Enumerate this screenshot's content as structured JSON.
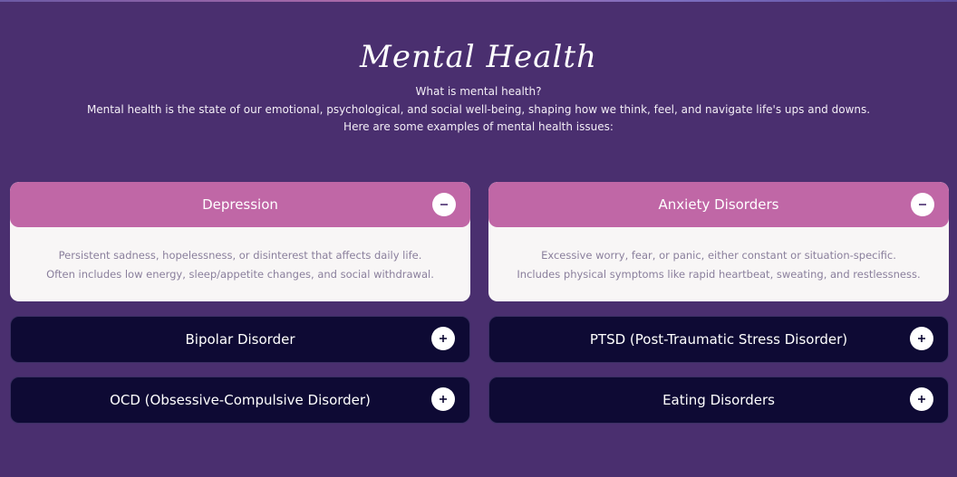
{
  "header": {
    "title": "Mental Health",
    "question": "What is mental health?",
    "definition": "Mental health is the state of our emotional, psychological, and social well-being, shaping how we think, feel, and navigate life's ups and downs.",
    "examples_intro": "Here are some examples of mental health issues:"
  },
  "cards": [
    {
      "title": "Depression",
      "state": "expanded",
      "toggle_icon": "minus-icon",
      "lines": [
        "Persistent sadness, hopelessness, or disinterest that affects daily life.",
        "Often includes low energy, sleep/appetite changes, and social withdrawal."
      ]
    },
    {
      "title": "Anxiety Disorders",
      "state": "expanded",
      "toggle_icon": "minus-icon",
      "lines": [
        "Excessive worry, fear, or panic, either constant or situation-specific.",
        "Includes physical symptoms like rapid heartbeat, sweating, and restlessness."
      ]
    },
    {
      "title": "Bipolar Disorder",
      "state": "collapsed",
      "toggle_icon": "plus-icon"
    },
    {
      "title": "PTSD (Post-Traumatic Stress Disorder)",
      "state": "collapsed",
      "toggle_icon": "plus-icon"
    },
    {
      "title": "OCD (Obsessive-Compulsive Disorder)",
      "state": "collapsed",
      "toggle_icon": "plus-icon"
    },
    {
      "title": "Eating Disorders",
      "state": "collapsed",
      "toggle_icon": "plus-icon"
    }
  ],
  "colors": {
    "background": "#4a2f6f",
    "expanded_header": "#c067a6",
    "expanded_body": "#f8f6f6",
    "collapsed_card": "#0e0a34",
    "body_text": "#8a7f9c"
  }
}
